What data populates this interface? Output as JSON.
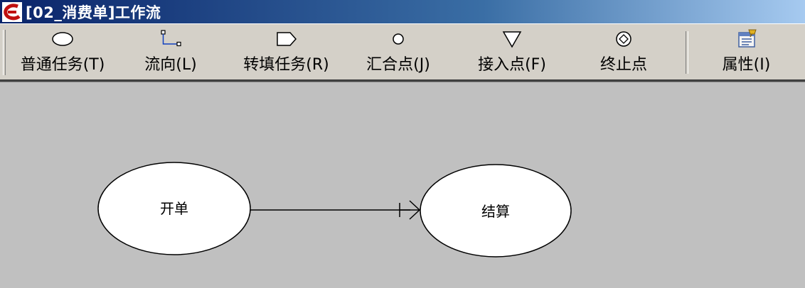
{
  "window": {
    "title": "[02_消费单]工作流"
  },
  "toolbar": {
    "buttons": [
      {
        "label": "普通任务(T)",
        "icon": "ellipse-icon"
      },
      {
        "label": "流向(L)",
        "icon": "flow-connector-icon"
      },
      {
        "label": "转填任务(R)",
        "icon": "pentagon-tag-icon"
      },
      {
        "label": "汇合点(J)",
        "icon": "small-circle-icon"
      },
      {
        "label": "接入点(F)",
        "icon": "down-triangle-icon"
      },
      {
        "label": "终止点",
        "icon": "diamond-in-circle-icon"
      },
      {
        "label": "属性(I)",
        "icon": "properties-icon"
      }
    ]
  },
  "workflow": {
    "nodes": [
      {
        "id": "start",
        "label": "开单"
      },
      {
        "id": "end",
        "label": "结算"
      }
    ],
    "edges": [
      {
        "from": "start",
        "to": "end"
      }
    ]
  }
}
